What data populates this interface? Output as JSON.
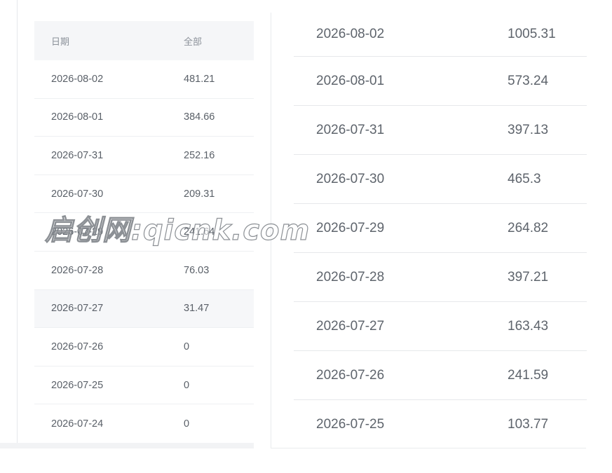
{
  "left_table": {
    "header": {
      "date": "日期",
      "value": "全部"
    },
    "rows": [
      {
        "date": "2026-08-02",
        "value": "481.21"
      },
      {
        "date": "2026-08-01",
        "value": "384.66"
      },
      {
        "date": "2026-07-31",
        "value": "252.16"
      },
      {
        "date": "2026-07-30",
        "value": "209.31"
      },
      {
        "date": "2026-07-29",
        "value": "241.64"
      },
      {
        "date": "2026-07-28",
        "value": "76.03"
      },
      {
        "date": "2026-07-27",
        "value": "31.47"
      },
      {
        "date": "2026-07-26",
        "value": "0"
      },
      {
        "date": "2026-07-25",
        "value": "0"
      },
      {
        "date": "2026-07-24",
        "value": "0"
      }
    ]
  },
  "right_table": {
    "rows": [
      {
        "date": "2026-08-02",
        "value": "1005.31"
      },
      {
        "date": "2026-08-01",
        "value": "573.24"
      },
      {
        "date": "2026-07-31",
        "value": "397.13"
      },
      {
        "date": "2026-07-30",
        "value": "465.3"
      },
      {
        "date": "2026-07-29",
        "value": "264.82"
      },
      {
        "date": "2026-07-28",
        "value": "397.21"
      },
      {
        "date": "2026-07-27",
        "value": "163.43"
      },
      {
        "date": "2026-07-26",
        "value": "241.59"
      },
      {
        "date": "2026-07-25",
        "value": "103.77"
      }
    ]
  },
  "watermark": {
    "text": "启创网:qicnk.com"
  },
  "colors": {
    "header_bg": "#f5f6f8",
    "row_border": "#eef0f2",
    "text": "#5a6068",
    "header_text": "#8c929a",
    "highlight_row": "#f6f7f9"
  }
}
